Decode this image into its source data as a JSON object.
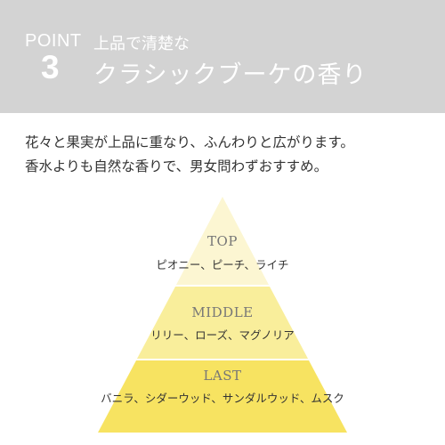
{
  "header": {
    "point_label": "POINT",
    "point_number": "3",
    "subtitle": "上品で清楚な",
    "title": "クラシックブーケの香り"
  },
  "description": {
    "lines": [
      "花々と果実が上品に重なり、ふんわりと広がります。",
      "香水よりも自然な香りで、男女問わずおすすめ。"
    ]
  },
  "pyramid": {
    "tiers": [
      {
        "name": "TOP",
        "notes": "ピオニー、ピーチ、ライチ",
        "color": "#fcf6d2"
      },
      {
        "name": "MIDDLE",
        "notes": "リリー、ローズ、マグノリア",
        "color": "#f9ee9b"
      },
      {
        "name": "LAST",
        "notes": "バニラ、シダーウッド、サンダルウッド、ムスク",
        "color": "#f7e361"
      }
    ]
  },
  "colors": {
    "banner": "#d3d3d3",
    "banner_text": "#ffffff",
    "body_text": "#333333"
  }
}
